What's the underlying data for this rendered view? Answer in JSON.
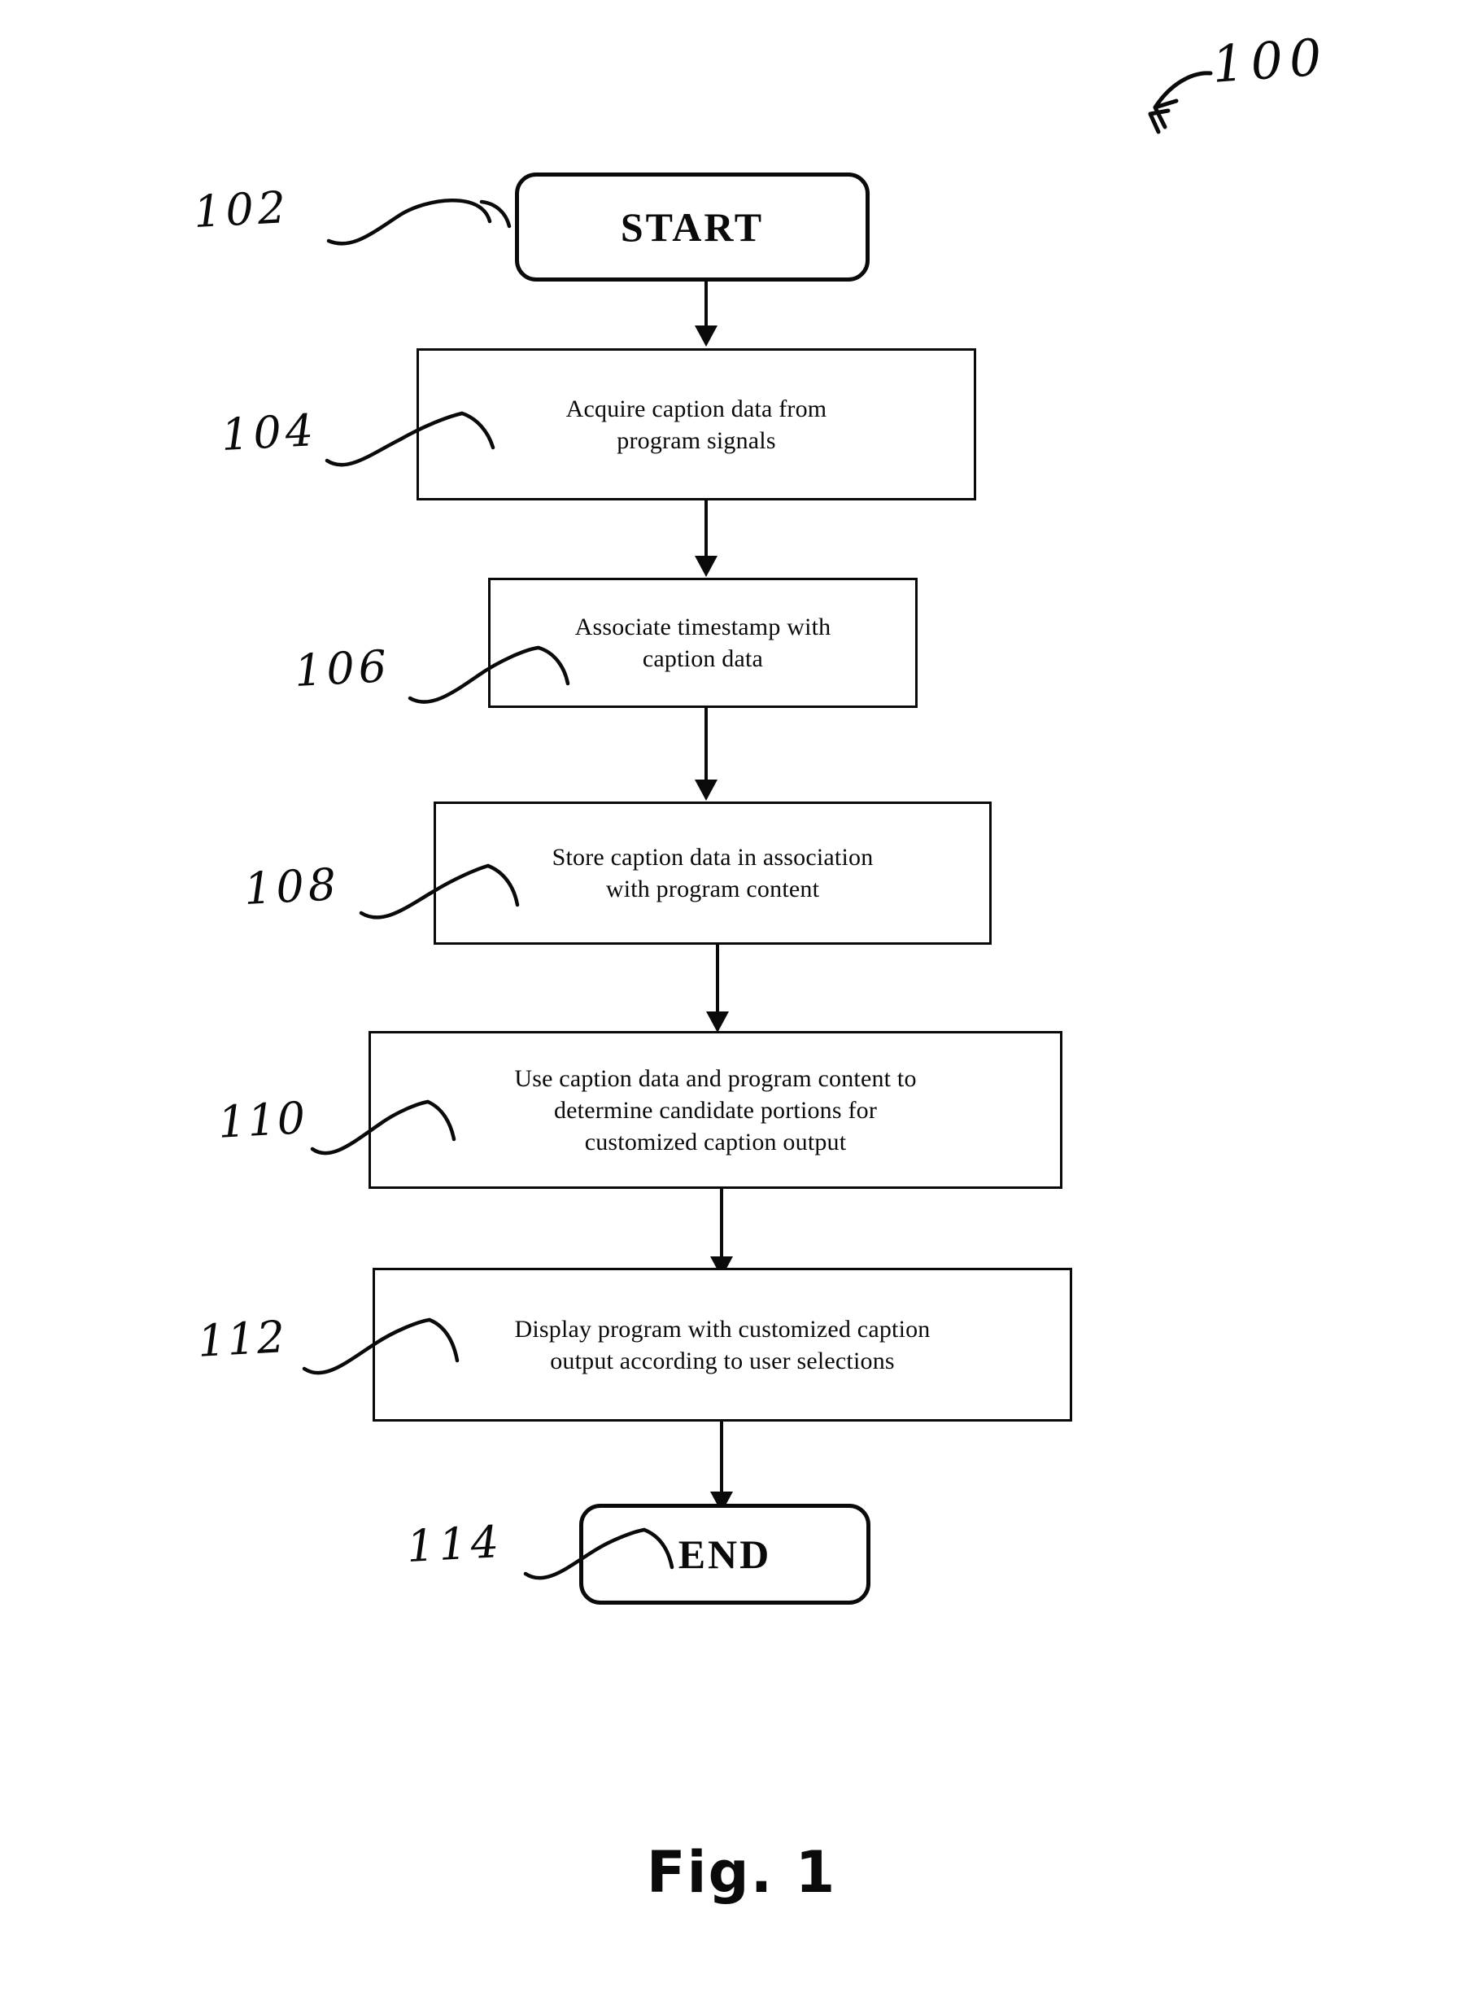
{
  "figure": {
    "caption": "Fig. 1",
    "overall_reference": "100"
  },
  "flowchart": {
    "type": "process-flow",
    "orientation": "top-to-bottom",
    "nodes": [
      {
        "ref": "102",
        "shape": "rounded-terminal",
        "text": "START"
      },
      {
        "ref": "104",
        "shape": "rectangle",
        "text": "Acquire caption data from\nprogram signals"
      },
      {
        "ref": "106",
        "shape": "rectangle",
        "text": "Associate timestamp with\ncaption data"
      },
      {
        "ref": "108",
        "shape": "rectangle",
        "text": "Store caption data in association\nwith program content"
      },
      {
        "ref": "110",
        "shape": "rectangle",
        "text": "Use caption data and program content to\ndetermine candidate portions for\ncustomized caption output"
      },
      {
        "ref": "112",
        "shape": "rectangle",
        "text": "Display program with customized caption\noutput according to user selections"
      },
      {
        "ref": "114",
        "shape": "rounded-terminal",
        "text": "END"
      }
    ],
    "edges": [
      {
        "from": "102",
        "to": "104",
        "style": "arrow-down"
      },
      {
        "from": "104",
        "to": "106",
        "style": "arrow-down"
      },
      {
        "from": "106",
        "to": "108",
        "style": "arrow-down"
      },
      {
        "from": "108",
        "to": "110",
        "style": "arrow-down"
      },
      {
        "from": "110",
        "to": "112",
        "style": "arrow-down"
      },
      {
        "from": "112",
        "to": "114",
        "style": "arrow-down"
      }
    ]
  },
  "colors": {
    "ink": "#0a0a0a",
    "paper": "#ffffff"
  }
}
